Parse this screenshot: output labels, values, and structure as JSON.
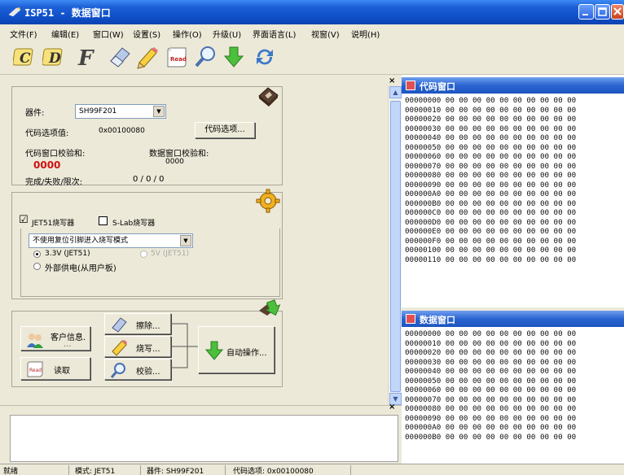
{
  "window": {
    "title": "ISP51 - 数据窗口"
  },
  "menu": {
    "items": [
      "文件(F)",
      "编辑(E)",
      "窗口(W)",
      "设置(S)",
      "操作(O)",
      "升级(U)",
      "界面语言(L)",
      "视窗(V)",
      "说明(H)"
    ]
  },
  "toolbar": {
    "tools": [
      "c-icon",
      "d-icon",
      "f-icon",
      "eraser-icon",
      "pencil-icon",
      "read-icon",
      "verify-icon",
      "download-icon",
      "sync-icon"
    ]
  },
  "device_panel": {
    "device_label": "器件:",
    "device_value": "SH99F201",
    "option_value_label": "代码选项值:",
    "option_value": "0x00100080",
    "code_options_button": "代码选项...",
    "code_checksum_label": "代码窗口校验和:",
    "code_checksum_value": "0000",
    "data_checksum_label": "数据窗口校验和:",
    "data_checksum_value": "0000",
    "result_label": "完成/失败/限次:",
    "result_value": "0 / 0 / 0"
  },
  "writer_panel": {
    "jet51_label": "JET51烧写器",
    "jet51_checked": "☑",
    "slab_label": "S-Lab烧写器",
    "mode_value": "不使用复位引脚进入烧写模式",
    "v33_label": "3.3V (JET51)",
    "v5_label": "5V (JET51)",
    "ext_power_label": "外部供电(从用户板)"
  },
  "action_panel": {
    "customer_info": "客户信息.",
    "customer_info_sub": "...",
    "read": "读取",
    "erase": "擦除...",
    "program": "烧写...",
    "verify": "校验...",
    "auto_op": "自动操作..."
  },
  "code_window": {
    "title": "代码窗口",
    "rows": [
      "00000000 00 00 00 00 00 00 00 00 00 00",
      "00000010 00 00 00 00 00 00 00 00 00 00",
      "00000020 00 00 00 00 00 00 00 00 00 00",
      "00000030 00 00 00 00 00 00 00 00 00 00",
      "00000040 00 00 00 00 00 00 00 00 00 00",
      "00000050 00 00 00 00 00 00 00 00 00 00",
      "00000060 00 00 00 00 00 00 00 00 00 00",
      "00000070 00 00 00 00 00 00 00 00 00 00",
      "00000080 00 00 00 00 00 00 00 00 00 00",
      "00000090 00 00 00 00 00 00 00 00 00 00",
      "000000A0 00 00 00 00 00 00 00 00 00 00",
      "000000B0 00 00 00 00 00 00 00 00 00 00",
      "000000C0 00 00 00 00 00 00 00 00 00 00",
      "000000D0 00 00 00 00 00 00 00 00 00 00",
      "000000E0 00 00 00 00 00 00 00 00 00 00",
      "000000F0 00 00 00 00 00 00 00 00 00 00",
      "00000100 00 00 00 00 00 00 00 00 00 00",
      "00000110 00 00 00 00 00 00 00 00 00 00"
    ]
  },
  "data_window": {
    "title": "数据窗口",
    "rows": [
      "00000000 00 00 00 00 00 00 00 00 00 00",
      "00000010 00 00 00 00 00 00 00 00 00 00",
      "00000020 00 00 00 00 00 00 00 00 00 00",
      "00000030 00 00 00 00 00 00 00 00 00 00",
      "00000040 00 00 00 00 00 00 00 00 00 00",
      "00000050 00 00 00 00 00 00 00 00 00 00",
      "00000060 00 00 00 00 00 00 00 00 00 00",
      "00000070 00 00 00 00 00 00 00 00 00 00",
      "00000080 00 00 00 00 00 00 00 00 00 00",
      "00000090 00 00 00 00 00 00 00 00 00 00",
      "000000A0 00 00 00 00 00 00 00 00 00 00",
      "000000B0 00 00 00 00 00 00 00 00 00 00"
    ]
  },
  "statusbar": {
    "ready": "就绪",
    "mode": "模式: JET51",
    "device": "器件: SH99F201",
    "code_option": "代码选项: 0x00100080"
  },
  "colors": {
    "accent": "#0f4fc8",
    "checksum_red": "#d01010",
    "chrome": "#ece9d8"
  }
}
